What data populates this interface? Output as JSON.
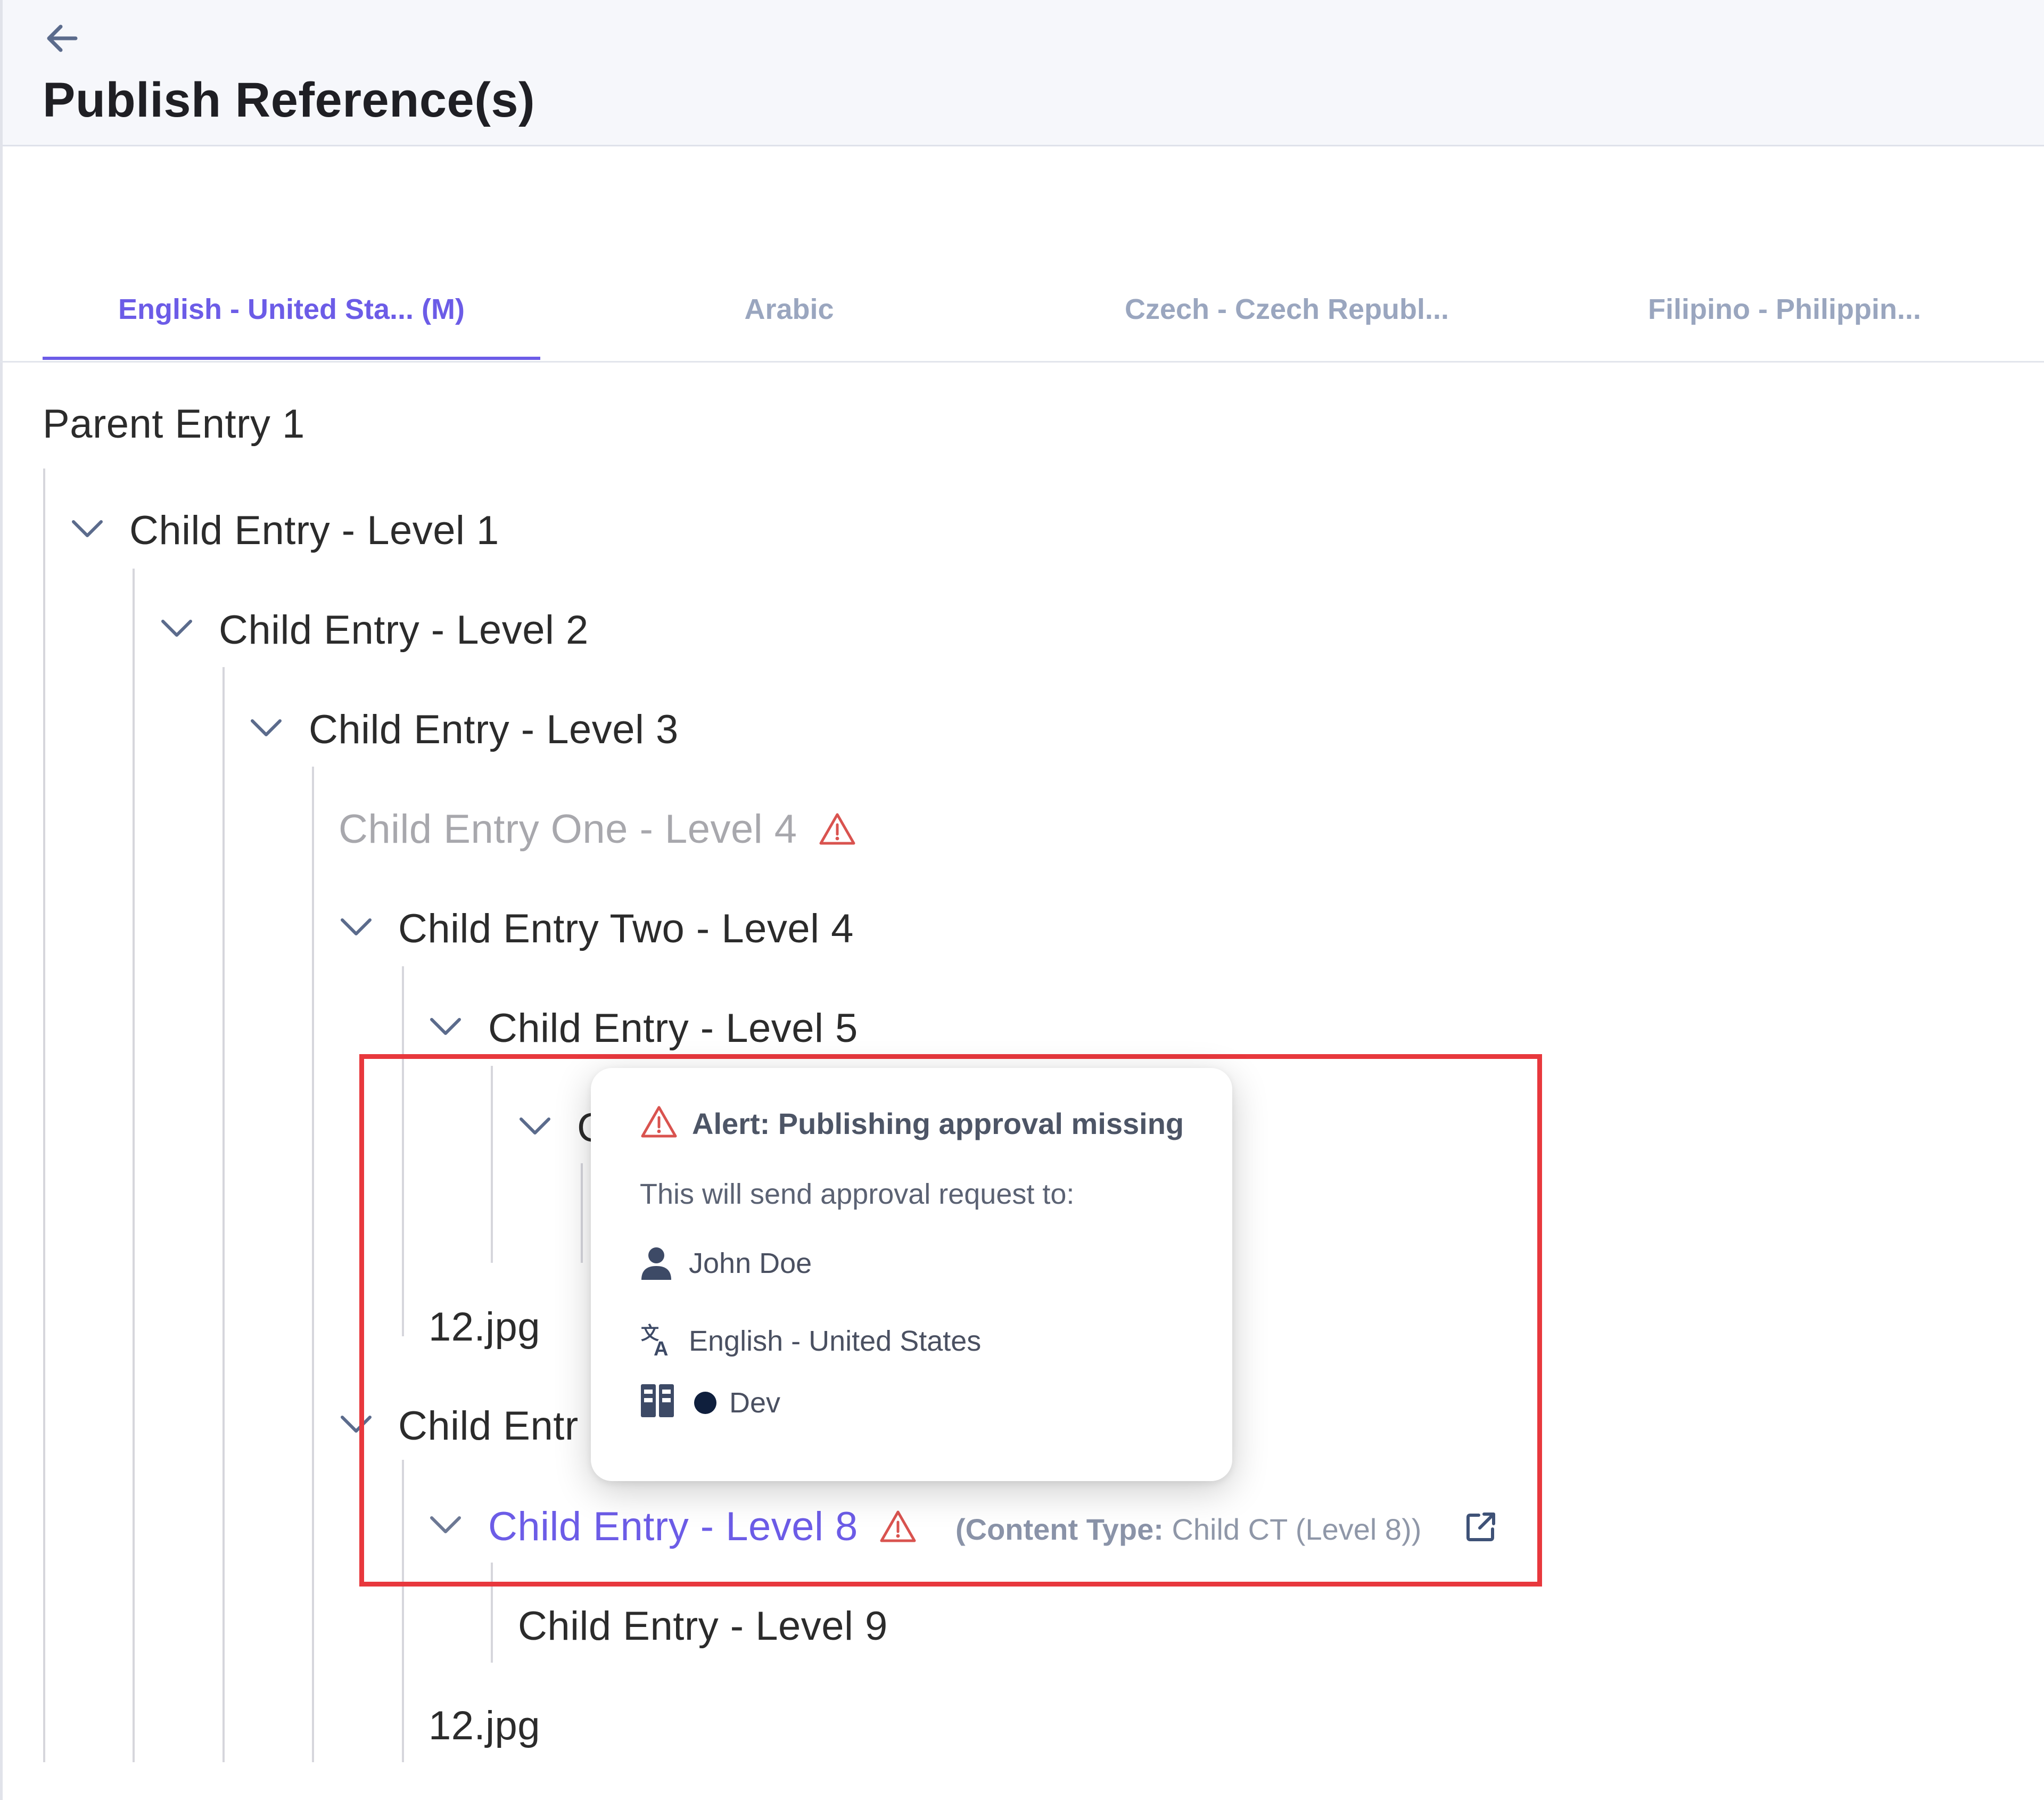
{
  "header": {
    "title": "Publish Reference(s)"
  },
  "tabs": [
    {
      "label": "English - United Sta... (M)",
      "active": true
    },
    {
      "label": "Arabic",
      "active": false
    },
    {
      "label": "Czech - Czech Republ...",
      "active": false
    },
    {
      "label": "Filipino - Philippin...",
      "active": false
    }
  ],
  "tree": {
    "root": "Parent Entry 1",
    "level1": "Child Entry - Level 1",
    "level2": "Child Entry - Level 2",
    "level3": "Child Entry - Level 3",
    "level4_one": "Child Entry One - Level 4",
    "level4_two": "Child Entry Two - Level 4",
    "level5": "Child Entry - Level 5",
    "level6_partial": "C",
    "asset_a": "12.jpg",
    "level7_partial": "Child Entr",
    "level8": "Child Entry - Level 8",
    "level8_meta_label": "(Content Type:",
    "level8_meta_value": "Child CT (Level 8))",
    "level9": "Child Entry - Level 9",
    "asset_b": "12.jpg"
  },
  "popover": {
    "title": "Alert: Publishing approval missing",
    "subtitle": "This will send approval request to:",
    "user": "John Doe",
    "language": "English - United States",
    "environment": "Dev"
  },
  "colors": {
    "accent": "#6c5ce7",
    "warning": "#d9534f",
    "highlight_border": "#e8383d",
    "env_dot": "#0f1f3d"
  }
}
